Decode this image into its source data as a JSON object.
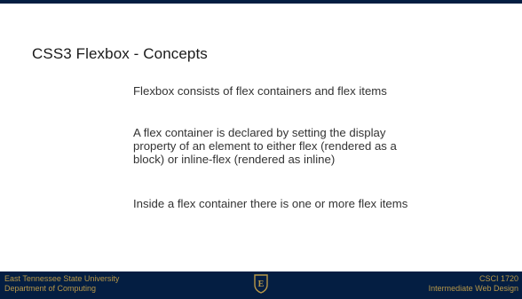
{
  "slide": {
    "title": "CSS3 Flexbox - Concepts",
    "bullets": [
      "Flexbox consists of flex containers and flex items",
      "A flex container is declared by setting the display property of an element to either flex (rendered as a block) or inline-flex (rendered as inline)",
      "Inside a flex container there is one or more flex items"
    ]
  },
  "footer": {
    "left_line1": "East Tennessee State University",
    "left_line2": "Department of Computing",
    "right_line1": "CSCI 1720",
    "right_line2": "Intermediate Web Design",
    "logo_letter": "E"
  },
  "colors": {
    "footer_bg": "#041e42",
    "footer_text": "#b79748"
  }
}
